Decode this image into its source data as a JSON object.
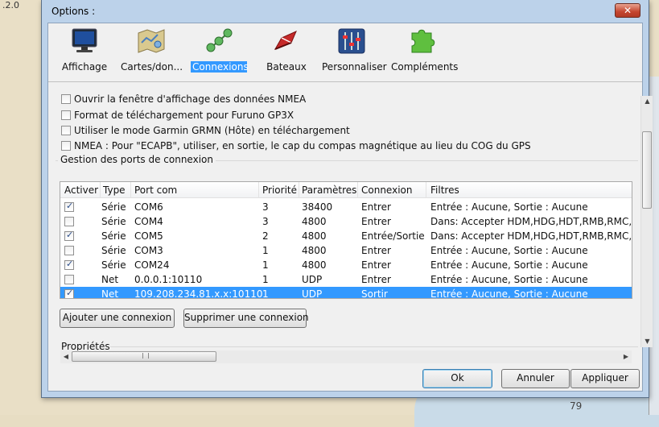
{
  "app": {
    "version_fragment": ".2.0",
    "map_depth_label": "79"
  },
  "dialog": {
    "title": "Options :",
    "close_glyph": "✕"
  },
  "toolbar": {
    "items": [
      {
        "label": "Affichage",
        "icon": "monitor-icon",
        "active": false
      },
      {
        "label": "Cartes/don...",
        "icon": "chart-map-icon",
        "active": false
      },
      {
        "label": "Connexions",
        "icon": "connections-icon",
        "active": true
      },
      {
        "label": "Bateaux",
        "icon": "boat-icon",
        "active": false
      },
      {
        "label": "Personnaliser",
        "icon": "sliders-icon",
        "active": false
      },
      {
        "label": "Compléments",
        "icon": "puzzle-icon",
        "active": false
      }
    ]
  },
  "options": [
    {
      "label": "Ouvrir la fenêtre d'affichage des données NMEA",
      "checked": false
    },
    {
      "label": "Format de téléchargement pour Furuno GP3X",
      "checked": false
    },
    {
      "label": "Utiliser le mode Garmin GRMN (Hôte) en téléchargement",
      "checked": false
    },
    {
      "label": "NMEA : Pour \"ECAPB\", utiliser, en sortie, le cap du compas magnétique  au lieu du COG du GPS",
      "checked": false
    }
  ],
  "ports_group": {
    "title": "Gestion des ports de connexion",
    "columns": [
      "Activer",
      "Type",
      "Port com",
      "Priorité",
      "Paramètres",
      "Connexion",
      "Filtres"
    ],
    "rows": [
      {
        "active": true,
        "type": "Série",
        "port": "COM6",
        "priority": "3",
        "params": "38400",
        "connection": "Entrer",
        "filters": "Entrée : Aucune, Sortie : Aucune",
        "selected": false
      },
      {
        "active": false,
        "type": "Série",
        "port": "COM4",
        "priority": "3",
        "params": "4800",
        "connection": "Entrer",
        "filters": "Dans: Accepter HDM,HDG,HDT,RMB,RMC,GL",
        "selected": false
      },
      {
        "active": true,
        "type": "Série",
        "port": "COM5",
        "priority": "2",
        "params": "4800",
        "connection": "Entrée/Sortie",
        "filters": "Dans: Accepter HDM,HDG,HDT,RMB,RMC,WI",
        "selected": false
      },
      {
        "active": false,
        "type": "Série",
        "port": "COM3",
        "priority": "1",
        "params": "4800",
        "connection": "Entrer",
        "filters": "Entrée : Aucune, Sortie : Aucune",
        "selected": false
      },
      {
        "active": true,
        "type": "Série",
        "port": "COM24",
        "priority": "1",
        "params": "4800",
        "connection": "Entrer",
        "filters": "Entrée : Aucune, Sortie : Aucune",
        "selected": false
      },
      {
        "active": false,
        "type": "Net",
        "port": "0.0.0.1:10110",
        "priority": "1",
        "params": "UDP",
        "connection": "Entrer",
        "filters": "Entrée : Aucune, Sortie : Aucune",
        "selected": false
      },
      {
        "active": true,
        "type": "Net",
        "port": "109.208.234.81.x.x:10110",
        "priority": "1",
        "params": "UDP",
        "connection": "Sortir",
        "filters": "Entrée : Aucune, Sortie : Aucune",
        "selected": true
      }
    ],
    "add_label": "Ajouter une connexion",
    "remove_label": "Supprimer une connexion"
  },
  "properties": {
    "title": "Propriétés"
  },
  "footer": {
    "ok_label": "Ok",
    "cancel_label": "Annuler",
    "apply_label": "Appliquer"
  },
  "colors": {
    "selection": "#3399ff",
    "frame": "#bcd2ea",
    "close": "#c4452f"
  }
}
